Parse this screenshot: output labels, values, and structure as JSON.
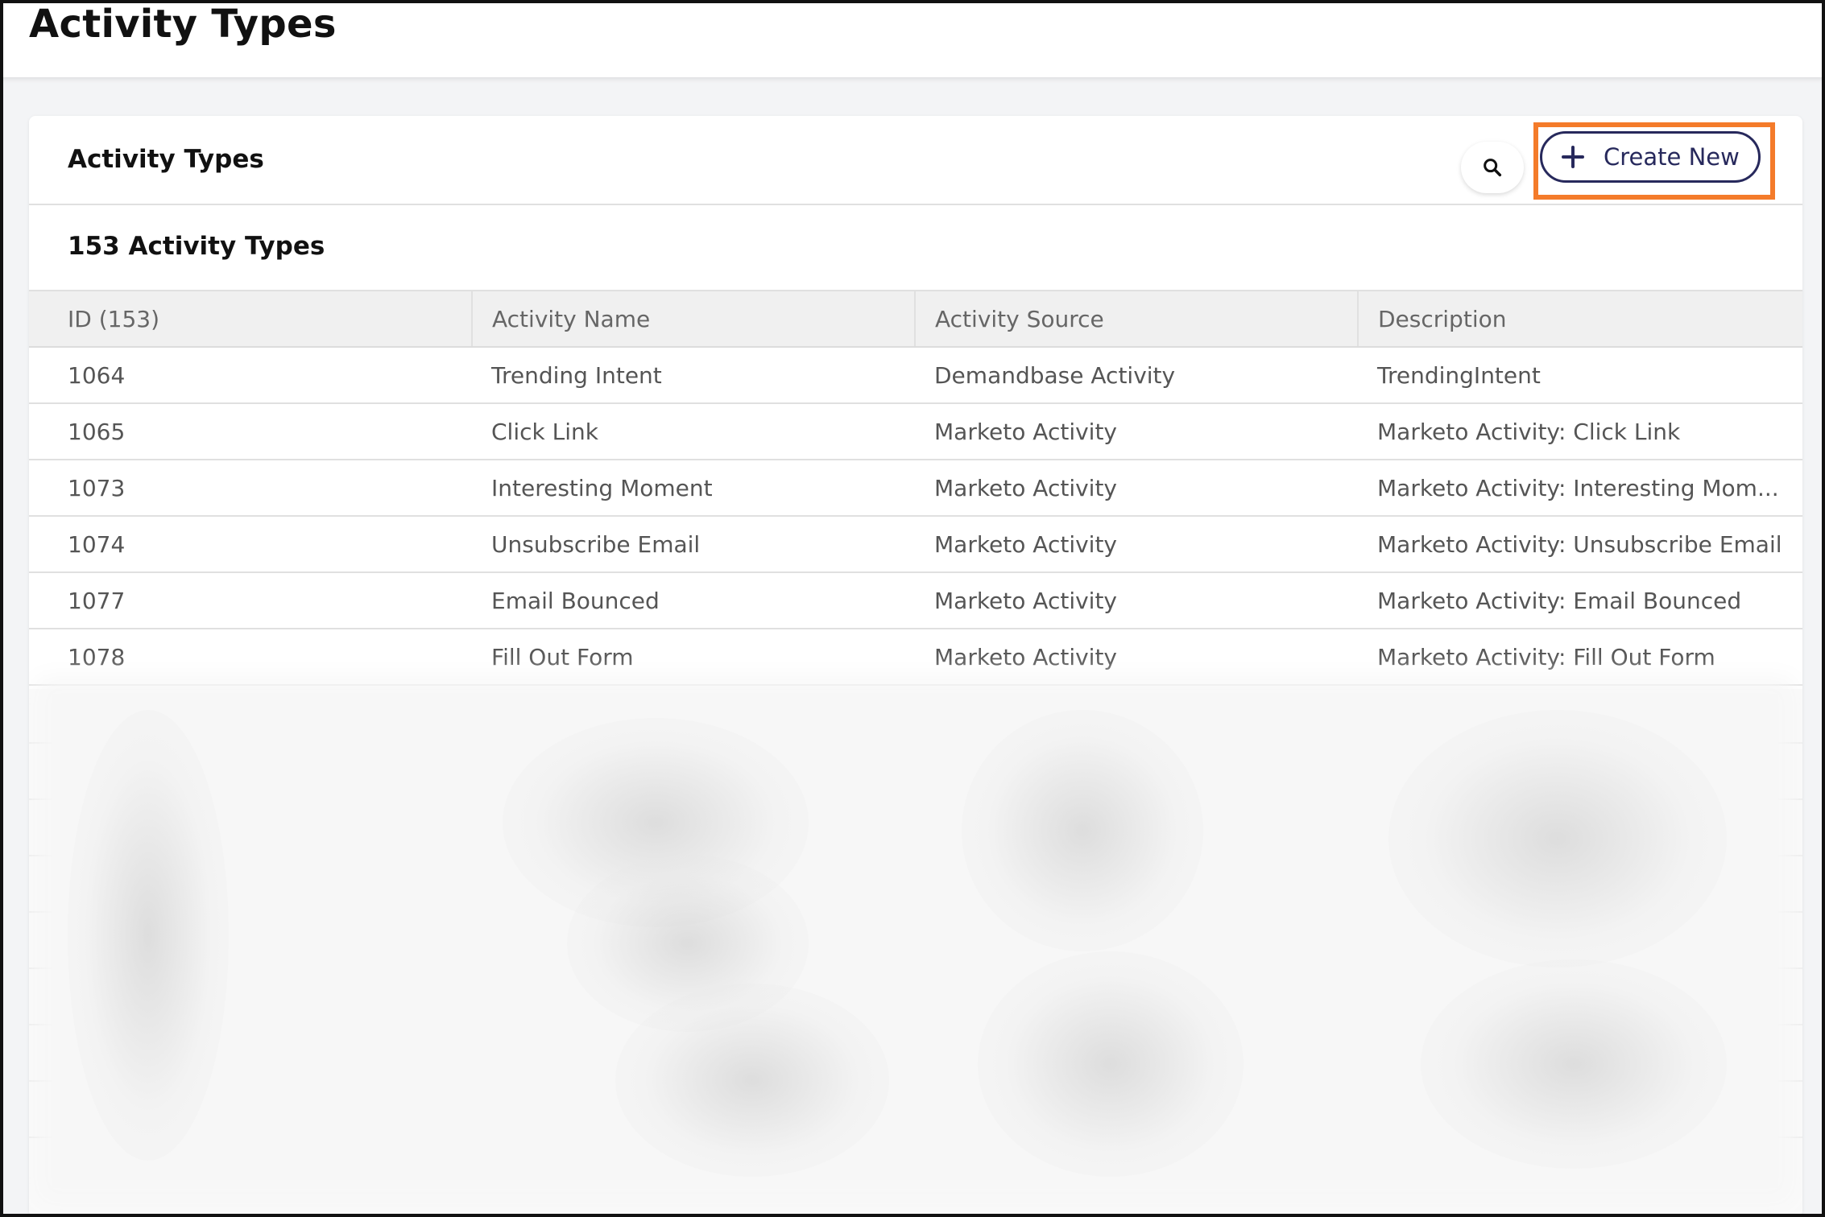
{
  "page": {
    "title": "Activity Types"
  },
  "card": {
    "title": "Activity Types",
    "count_label": "153 Activity Types",
    "search_icon": "search-icon",
    "create_button": {
      "icon": "plus-icon",
      "label": "Create New",
      "highlight_color": "#f47b2a"
    }
  },
  "table": {
    "columns": [
      "ID (153)",
      "Activity Name",
      "Activity Source",
      "Description"
    ],
    "rows": [
      [
        "1064",
        "Trending Intent",
        "Demandbase Activity",
        "TrendingIntent"
      ],
      [
        "1065",
        "Click Link",
        "Marketo Activity",
        "Marketo Activity: Click Link"
      ],
      [
        "1073",
        "Interesting Moment",
        "Marketo Activity",
        "Marketo Activity: Interesting Mom..."
      ],
      [
        "1074",
        "Unsubscribe Email",
        "Marketo Activity",
        "Marketo Activity: Unsubscribe Email"
      ],
      [
        "1077",
        "Email Bounced",
        "Marketo Activity",
        "Marketo Activity: Email Bounced"
      ],
      [
        "1078",
        "Fill Out Form",
        "Marketo Activity",
        "Marketo Activity: Fill Out Form"
      ]
    ]
  },
  "colors": {
    "accent": "#27295c",
    "highlight": "#f47b2a"
  }
}
